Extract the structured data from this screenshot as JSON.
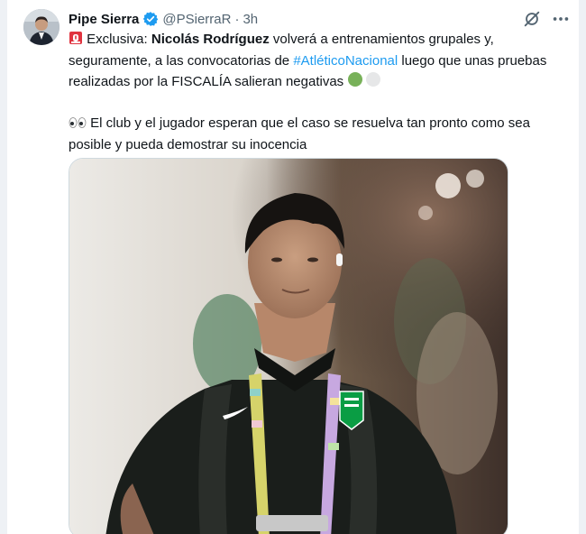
{
  "tweet": {
    "author_name": "Pipe Sierra",
    "handle": "@PSierraR",
    "separator": "·",
    "time": "3h",
    "verified": true,
    "paragraph1": {
      "prefix": "Exclusiva: ",
      "bold_name": "Nicolás Rodríguez",
      "text_a": " volverá a entrenamientos grupales y, seguramente, a las convocatorias de ",
      "hashtag": "#AtléticoNacional",
      "text_b": " luego que unas pruebas realizadas por la FISCALÍA salieran negativas "
    },
    "paragraph2": {
      "text": " El club y el jugador esperan que el caso se resuelva tan pronto como sea posible y pueda demostrar su inocencia"
    },
    "icons": {
      "siren": "siren-emoji-icon",
      "green_circle": "green-circle-emoji-icon",
      "white_circle": "white-circle-emoji-icon",
      "eyes": "eyes-emoji-icon",
      "verified": "verified-badge-icon",
      "grok": "grok-icon",
      "more": "more-icon"
    }
  },
  "colors": {
    "link": "#1d9bf0",
    "text": "#0f1419",
    "muted": "#536471",
    "verified": "#1d9bf0",
    "jersey_green": "#0a9d44"
  }
}
